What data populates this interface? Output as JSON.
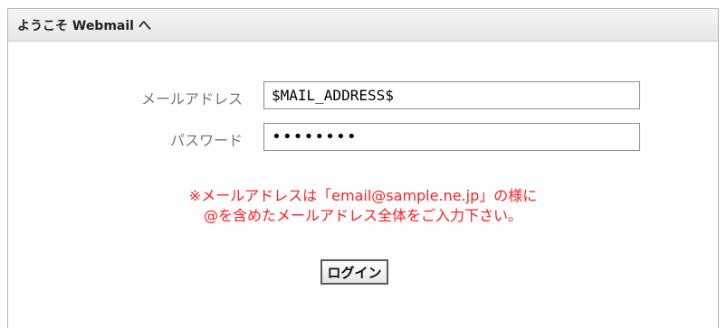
{
  "header": {
    "title": "ようこそ Webmail へ"
  },
  "form": {
    "email": {
      "label": "メールアドレス",
      "value": "$MAIL_ADDRESS$"
    },
    "password": {
      "label": "パスワード",
      "value": "••••••••"
    }
  },
  "notice": {
    "line1": "※メールアドレスは「email@sample.ne.jp」の様に",
    "line2": "@を含めたメールアドレス全体をご入力下さい。"
  },
  "login_button": {
    "label": "ログイン"
  },
  "colors": {
    "notice": "#ff2020",
    "label": "#777777"
  }
}
